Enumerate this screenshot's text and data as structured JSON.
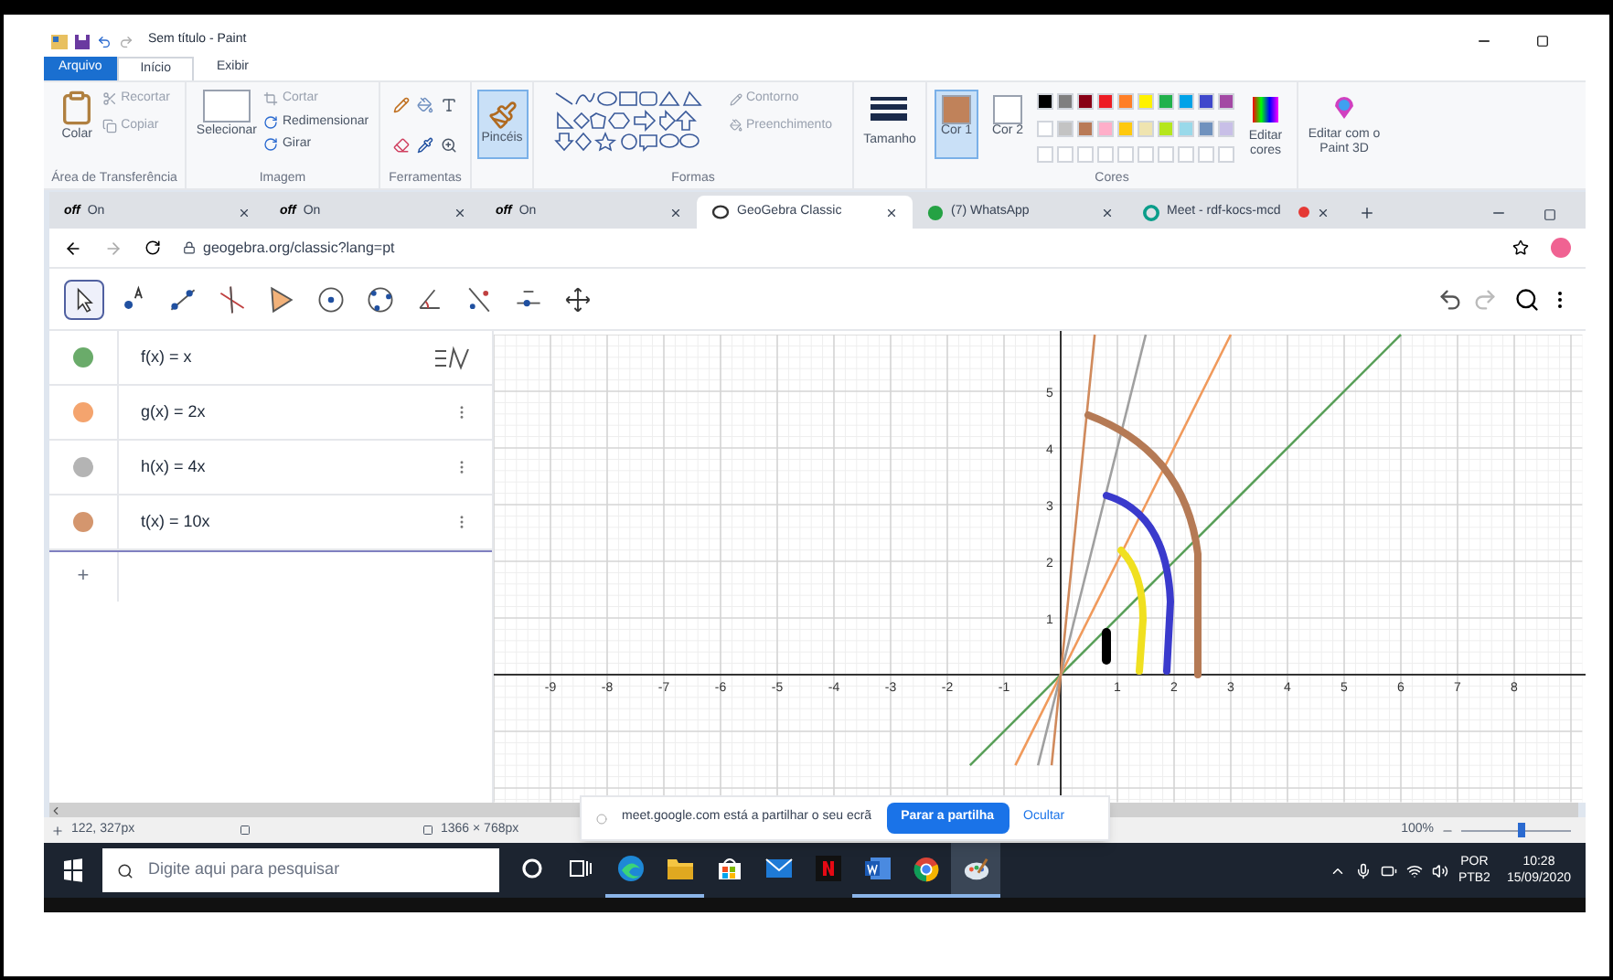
{
  "paint": {
    "title": "Sem título - Paint",
    "ribbon_tabs": [
      {
        "label": "Arquivo",
        "kind": "file",
        "selected": false
      },
      {
        "label": "Início",
        "kind": "tab",
        "selected": true
      },
      {
        "label": "Exibir",
        "kind": "tab",
        "selected": false
      }
    ],
    "clipboard": {
      "paste": "Colar",
      "cut": "Recortar",
      "copy": "Copiar",
      "label": "Área de Transferência"
    },
    "image": {
      "select": "Selecionar",
      "crop": "Cortar",
      "resize": "Redimensionar",
      "rotate": "Girar",
      "label": "Imagem"
    },
    "tools": {
      "label": "Ferramentas"
    },
    "brushes": {
      "label": "Pincéis",
      "selected": true
    },
    "shapes": {
      "outline": "Contorno",
      "fill": "Preenchimento",
      "label": "Formas"
    },
    "size": {
      "label": "Tamanho"
    },
    "colors": {
      "color1": {
        "label": "Cor 1",
        "color": "#c0825a",
        "selected": true
      },
      "color2": {
        "label": "Cor 2",
        "color": "#ffffff",
        "selected": false
      },
      "palette": [
        {
          "color": "#000000"
        },
        {
          "color": "#7f7f7f"
        },
        {
          "color": "#880015"
        },
        {
          "color": "#ed1c24"
        },
        {
          "color": "#ff7f27"
        },
        {
          "color": "#fff200"
        },
        {
          "color": "#22b14c"
        },
        {
          "color": "#00a2e8"
        },
        {
          "color": "#3f48cc"
        },
        {
          "color": "#a349a4"
        },
        {
          "color": "#ffffff"
        },
        {
          "color": "#c3c3c3"
        },
        {
          "color": "#b97a57"
        },
        {
          "color": "#ffaec9"
        },
        {
          "color": "#ffc90e"
        },
        {
          "color": "#efe4b0"
        },
        {
          "color": "#b5e61d"
        },
        {
          "color": "#99d9ea"
        },
        {
          "color": "#7092be"
        },
        {
          "color": "#c8bfe7"
        }
      ],
      "label": "Cores",
      "edit": "Editar cores"
    },
    "paint3d": "Editar com o Paint 3D",
    "status": {
      "cursor": "122, 327px",
      "dimensions": "1366 × 768px",
      "zoom": "100%",
      "level": 0.55
    }
  },
  "browser": {
    "tabs": [
      {
        "label": "On",
        "badge": "off",
        "kind": "off",
        "selected": false
      },
      {
        "label": "On",
        "badge": "off",
        "kind": "off",
        "selected": false
      },
      {
        "label": "On",
        "badge": "off",
        "kind": "off",
        "selected": false
      },
      {
        "label": "GeoGebra Classic",
        "kind": "geogebra",
        "selected": true
      },
      {
        "label": "(7) WhatsApp",
        "kind": "whatsapp",
        "selected": false
      },
      {
        "label": "Meet - rdf-kocs-mcd",
        "kind": "meet",
        "selected": false
      }
    ],
    "address": "geogebra.org/classic?lang=pt"
  },
  "geogebra": {
    "tools": [
      {
        "selected": true
      },
      {
        "selected": false
      },
      {
        "selected": false
      },
      {
        "selected": false
      },
      {
        "selected": false
      },
      {
        "selected": false
      },
      {
        "selected": false
      },
      {
        "selected": false
      },
      {
        "selected": false
      },
      {
        "selected": false
      },
      {
        "selected": false
      }
    ],
    "algebra": [
      {
        "expr": "f(x) = x",
        "color": "#6aab6a"
      },
      {
        "expr": "g(x) = 2x",
        "color": "#f4a46e"
      },
      {
        "expr": "h(x) = 4x",
        "color": "#b4b4b4"
      },
      {
        "expr": "t(x) = 10x",
        "color": "#d4966e"
      }
    ],
    "input": {
      "add": "+"
    },
    "chart_data": {
      "type": "line",
      "grid": true,
      "x": [
        -1.6,
        -0.8,
        -0.4,
        -0.16,
        0,
        0.6,
        1.5,
        3,
        6
      ],
      "xlim": [
        -10,
        9.2
      ],
      "ylim": [
        -2.25,
        6
      ],
      "xticks": [
        -9,
        -8,
        -7,
        -6,
        -5,
        -4,
        -3,
        -2,
        -1,
        1,
        2,
        3,
        4,
        5,
        6,
        7,
        8
      ],
      "yticks": [
        1,
        2,
        3,
        4,
        5
      ],
      "series": [
        {
          "color": "#5aa05a",
          "values": [
            -1.6,
            -0.8,
            -0.4,
            -0.16,
            0,
            0.6,
            1.5,
            3,
            6
          ]
        },
        {
          "color": "#f09a5c",
          "values": [
            null,
            -1.6,
            -0.8,
            -0.32,
            0,
            1.2,
            3,
            6,
            null
          ]
        },
        {
          "color": "#a0a0a0",
          "values": [
            null,
            null,
            -1.6,
            -0.64,
            0,
            2.4,
            6,
            null,
            null
          ]
        },
        {
          "color": "#d08a5c",
          "values": [
            null,
            null,
            null,
            -1.6,
            0,
            6,
            null,
            null,
            null
          ]
        }
      ]
    }
  },
  "share_bar": {
    "text": "meet.google.com está a partilhar o seu ecrã",
    "stop": "Parar a partilha",
    "hide": "Ocultar"
  },
  "taskbar": {
    "search": {
      "placeholder": "Digite aqui para pesquisar"
    },
    "apps": [
      {
        "kind": "cortana",
        "running": false
      },
      {
        "kind": "taskview",
        "running": false
      },
      {
        "kind": "edge",
        "running": true
      },
      {
        "kind": "explorer",
        "running": true
      },
      {
        "kind": "store",
        "running": false
      },
      {
        "kind": "mail",
        "running": false
      },
      {
        "kind": "netflix",
        "running": false
      },
      {
        "kind": "word",
        "running": true
      },
      {
        "kind": "chrome",
        "running": true
      },
      {
        "kind": "paint",
        "running": true
      }
    ],
    "language": "POR",
    "layout": "PTB2",
    "time": "10:28",
    "date": "15/09/2020"
  }
}
